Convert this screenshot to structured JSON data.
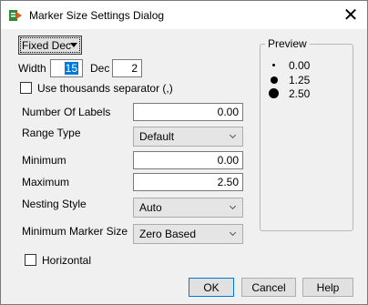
{
  "window": {
    "title": "Marker Size Settings Dialog",
    "close_glyph": "✕",
    "icon": "app-icon"
  },
  "format": {
    "selected": "Fixed Dec"
  },
  "width": {
    "label": "Width",
    "value": "15"
  },
  "dec": {
    "label": "Dec",
    "value": "2"
  },
  "thousands": {
    "label": "Use thousands separator (,)",
    "checked": false
  },
  "fields": {
    "number_of_labels": {
      "label": "Number Of Labels",
      "value": "0.00"
    },
    "range_type": {
      "label": "Range Type",
      "value": "Default"
    },
    "minimum": {
      "label": "Minimum",
      "value": "0.00"
    },
    "maximum": {
      "label": "Maximum",
      "value": "2.50"
    },
    "nesting_style": {
      "label": "Nesting Style",
      "value": "Auto"
    },
    "min_marker_size": {
      "label": "Minimum Marker Size",
      "value": "Zero Based"
    }
  },
  "horizontal": {
    "label": "Horizontal",
    "checked": false
  },
  "preview": {
    "title": "Preview",
    "items": [
      {
        "value": "0.00",
        "dot": "small"
      },
      {
        "value": "1.25",
        "dot": "medium"
      },
      {
        "value": "2.50",
        "dot": "large"
      }
    ]
  },
  "buttons": {
    "ok": "OK",
    "cancel": "Cancel",
    "help": "Help"
  },
  "colors": {
    "selection": "#0078d7",
    "window_bg": "#f0f0f0",
    "default_button_border": "#0078d7"
  }
}
